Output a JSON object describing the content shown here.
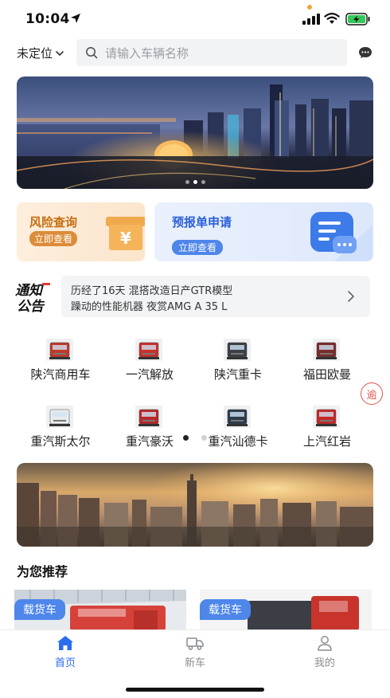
{
  "status_bar": {
    "time": "10:04"
  },
  "header": {
    "location": "未定位",
    "search_placeholder": "请输入车辆名称"
  },
  "quick_cards": {
    "risk": {
      "title": "风险查询",
      "button": "立即查看"
    },
    "report": {
      "title": "预报单申请",
      "button": "立即查看"
    }
  },
  "notice": {
    "logo_top": "通知",
    "logo_bottom": "公告",
    "line1": "历经了16天 混搭改造日产GTR模型",
    "line2": "躁动的性能机器 夜赏AMG A 35 L"
  },
  "brands": [
    {
      "label": "陕汽商用车",
      "truck_color": "#c0392b"
    },
    {
      "label": "一汽解放",
      "truck_color": "#c9302c"
    },
    {
      "label": "陕汽重卡",
      "truck_color": "#3b3f46"
    },
    {
      "label": "福田欧曼",
      "truck_color": "#7b2a2a"
    },
    {
      "label": "重汽斯太尔",
      "truck_color": "#e9ecef"
    },
    {
      "label": "重汽豪沃",
      "truck_color": "#b8282a"
    },
    {
      "label": "重汽汕德卡",
      "truck_color": "#2d3a4a"
    },
    {
      "label": "上汽红岩",
      "truck_color": "#c62828"
    }
  ],
  "overdue_badge": "逾",
  "recommend": {
    "title": "为您推荐",
    "cards": [
      {
        "tag": "载货车"
      },
      {
        "tag": "载货车"
      }
    ]
  },
  "tab_bar": {
    "tabs": [
      {
        "label": "首页",
        "icon": "home-icon",
        "active": true
      },
      {
        "label": "新车",
        "icon": "truck-icon",
        "active": false
      },
      {
        "label": "我的",
        "icon": "user-icon",
        "active": false
      }
    ]
  },
  "colors": {
    "accent": "#2b6cf0",
    "risk_orange": "#c56f12",
    "report_blue": "#2b5fd9",
    "tag_blue": "#4e86ea"
  }
}
